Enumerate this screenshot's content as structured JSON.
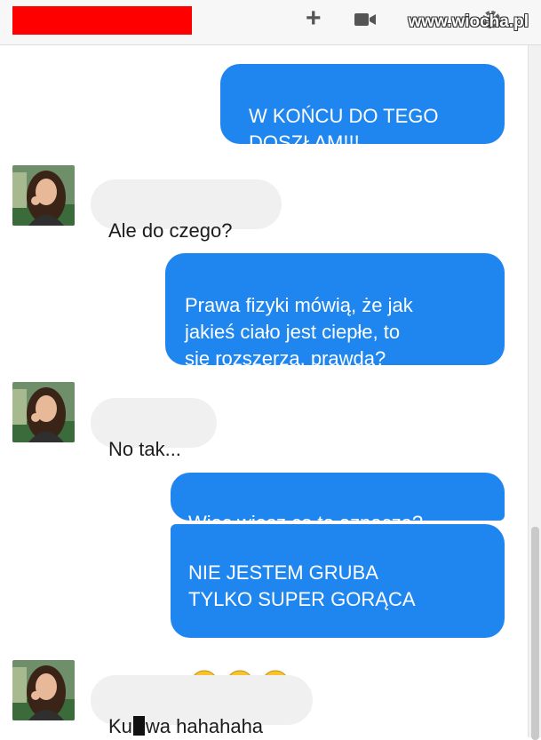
{
  "header": {
    "watermark": "www.wiocha.pl"
  },
  "messages": [
    {
      "sender": "me",
      "text": "W KOŃCU DO TEGO\nDOSZŁAM!!!"
    },
    {
      "sender": "contact",
      "text": "Ale do czego?"
    },
    {
      "sender": "me",
      "text": "Prawa fizyki mówią, że jak\njakieś ciało jest ciepłe, to\nsię rozszerza, prawda?"
    },
    {
      "sender": "contact",
      "text": "No tak..."
    },
    {
      "sender": "me",
      "text": "Więc wiesz co to oznacza?"
    },
    {
      "sender": "me",
      "text": "NIE JESTEM GRUBA\nTYLKO SUPER GORĄCA",
      "emojis": [
        "laughing-tears-emoji",
        "laughing-tears-emoji",
        "laughing-tears-emoji"
      ]
    },
    {
      "sender": "contact",
      "text_before": "Ku",
      "text_after": "wa hahahaha",
      "censored": true
    }
  ],
  "colors": {
    "outgoing_bubble": "#1f86f0",
    "incoming_bubble": "#f0f0f0",
    "redaction": "#ff0000"
  },
  "icons": [
    "plus-icon",
    "video-camera-icon",
    "gear-icon",
    "avatar-photo"
  ]
}
